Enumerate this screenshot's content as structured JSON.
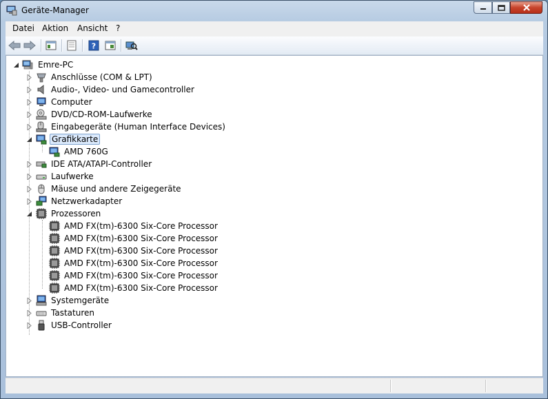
{
  "window": {
    "title": "Geräte-Manager"
  },
  "menu": {
    "items": [
      "Datei",
      "Aktion",
      "Ansicht",
      "?"
    ]
  },
  "toolbar": {
    "buttons": [
      "back-icon",
      "forward-icon",
      "console-tree-icon",
      "properties-icon",
      "help-icon",
      "show-hide-icon",
      "scan-hardware-icon"
    ]
  },
  "tree": {
    "root": "Emre-PC",
    "categories": [
      {
        "label": "Anschlüsse (COM & LPT)",
        "icon": "port-icon",
        "expanded": false
      },
      {
        "label": "Audio-, Video- und Gamecontroller",
        "icon": "speaker-icon",
        "expanded": false
      },
      {
        "label": "Computer",
        "icon": "computer-icon",
        "expanded": false
      },
      {
        "label": "DVD/CD-ROM-Laufwerke",
        "icon": "dvd-drive-icon",
        "expanded": false
      },
      {
        "label": "Eingabegeräte (Human Interface Devices)",
        "icon": "hid-icon",
        "expanded": false
      },
      {
        "label": "Grafikkarte",
        "icon": "display-adapter-icon",
        "expanded": true,
        "selected": true,
        "children": [
          "AMD 760G"
        ]
      },
      {
        "label": "IDE ATA/ATAPI-Controller",
        "icon": "ide-controller-icon",
        "expanded": false
      },
      {
        "label": "Laufwerke",
        "icon": "disk-drive-icon",
        "expanded": false
      },
      {
        "label": "Mäuse und andere Zeigegeräte",
        "icon": "mouse-icon",
        "expanded": false
      },
      {
        "label": "Netzwerkadapter",
        "icon": "network-adapter-icon",
        "expanded": false
      },
      {
        "label": "Prozessoren",
        "icon": "processor-icon",
        "expanded": true,
        "children": [
          "AMD FX(tm)-6300 Six-Core Processor",
          "AMD FX(tm)-6300 Six-Core Processor",
          "AMD FX(tm)-6300 Six-Core Processor",
          "AMD FX(tm)-6300 Six-Core Processor",
          "AMD FX(tm)-6300 Six-Core Processor",
          "AMD FX(tm)-6300 Six-Core Processor"
        ]
      },
      {
        "label": "Systemgeräte",
        "icon": "system-device-icon",
        "expanded": false
      },
      {
        "label": "Tastaturen",
        "icon": "keyboard-icon",
        "expanded": false
      },
      {
        "label": "USB-Controller",
        "icon": "usb-icon",
        "expanded": false
      }
    ]
  },
  "colors": {
    "selection": "#dceafc",
    "selection_border": "#7da2ce",
    "frame": "#b6cbe2"
  }
}
